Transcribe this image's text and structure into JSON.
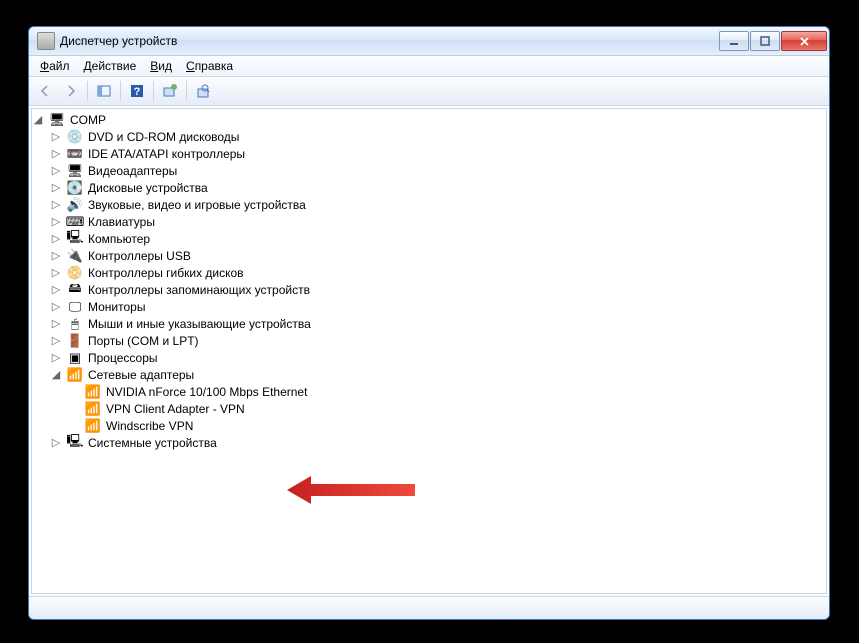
{
  "title": "Диспетчер устройств",
  "menu": {
    "file": "Файл",
    "action": "Действие",
    "view": "Вид",
    "help": "Справка"
  },
  "root": "COMP",
  "cats": [
    {
      "label": "DVD и CD-ROM дисководы",
      "icon": "💿"
    },
    {
      "label": "IDE ATA/ATAPI контроллеры",
      "icon": "📼"
    },
    {
      "label": "Видеоадаптеры",
      "icon": "🖥"
    },
    {
      "label": "Дисковые устройства",
      "icon": "💽"
    },
    {
      "label": "Звуковые, видео и игровые устройства",
      "icon": "🔊"
    },
    {
      "label": "Клавиатуры",
      "icon": "⌨"
    },
    {
      "label": "Компьютер",
      "icon": "🖳"
    },
    {
      "label": "Контроллеры USB",
      "icon": "🔌"
    },
    {
      "label": "Контроллеры гибких дисков",
      "icon": "📀"
    },
    {
      "label": "Контроллеры запоминающих устройств",
      "icon": "🖴"
    },
    {
      "label": "Мониторы",
      "icon": "🖵"
    },
    {
      "label": "Мыши и иные указывающие устройства",
      "icon": "🖱"
    },
    {
      "label": "Порты (COM и LPT)",
      "icon": "🚪"
    },
    {
      "label": "Процессоры",
      "icon": "▣"
    },
    {
      "label": "Сетевые адаптеры",
      "icon": "📶",
      "expanded": true,
      "children": [
        {
          "label": "NVIDIA nForce 10/100 Mbps Ethernet",
          "icon": "📶"
        },
        {
          "label": "VPN Client Adapter - VPN",
          "icon": "📶"
        },
        {
          "label": "Windscribe VPN",
          "icon": "📶"
        }
      ]
    },
    {
      "label": "Системные устройства",
      "icon": "🖳"
    }
  ]
}
